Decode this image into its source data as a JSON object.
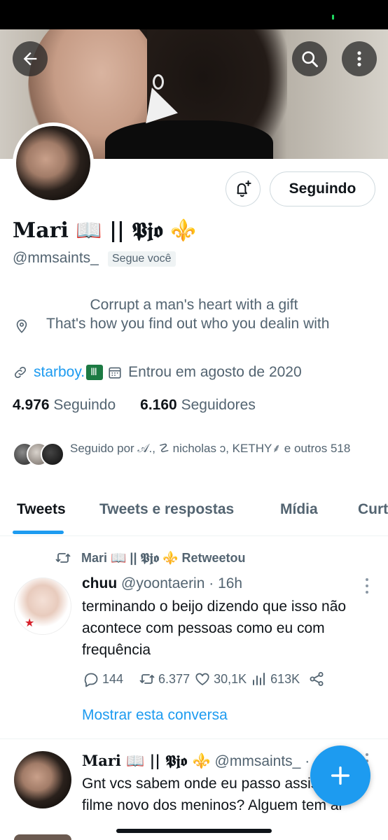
{
  "profile": {
    "display_name": "Mari 📖 || 𝕻𝖏𝖔 ⚜️",
    "handle": "@mmsaints_",
    "follows_you": "Segue você",
    "bio_line1": "Corrupt a man's heart with a gift",
    "bio_line2": "That's how you find out who you dealin with",
    "link": "starboy.",
    "joined": "Entrou em agosto de 2020",
    "following_count": "4.976",
    "following_label": "Seguindo",
    "followers_count": "6.160",
    "followers_label": "Seguidores",
    "followed_by": "Seguido por 𝒜., ☡ nicholas ↄ, KETHY⸙ e outros 518"
  },
  "actions": {
    "follow_button": "Seguindo"
  },
  "tabs": [
    {
      "label": "Tweets",
      "active": true
    },
    {
      "label": "Tweets e respostas",
      "active": false
    },
    {
      "label": "Mídia",
      "active": false
    },
    {
      "label": "Curt",
      "active": false
    }
  ],
  "tweets": [
    {
      "retweet_label": "Mari 📖 || 𝕻𝖏𝖔 ⚜️ Retweetou",
      "author": "chuu",
      "handle": "@yoontaerin",
      "time": "· 16h",
      "text": "terminando o beijo dizendo que isso não acontece com pessoas como eu com frequência",
      "replies": "144",
      "retweets": "6.377",
      "likes": "30,1K",
      "views": "613K",
      "show_thread": "Mostrar esta conversa"
    },
    {
      "author": "Mari 📖 || 𝕻𝖏𝖔 ⚜️",
      "handle": "@mmsaints_",
      "time": "·",
      "text": "Gnt vcs sabem onde eu passo assistir o filme novo dos meninos? Alguem tem ai"
    }
  ],
  "colors": {
    "accent": "#1d9bf0",
    "text": "#0f1419",
    "secondary": "#536471"
  },
  "icons": [
    "back-arrow-icon",
    "search-icon",
    "more-vertical-icon",
    "bell-plus-icon",
    "location-pin-icon",
    "link-icon",
    "calendar-icon",
    "retweet-icon",
    "reply-icon",
    "like-icon",
    "views-icon",
    "share-icon",
    "compose-plus-icon"
  ]
}
